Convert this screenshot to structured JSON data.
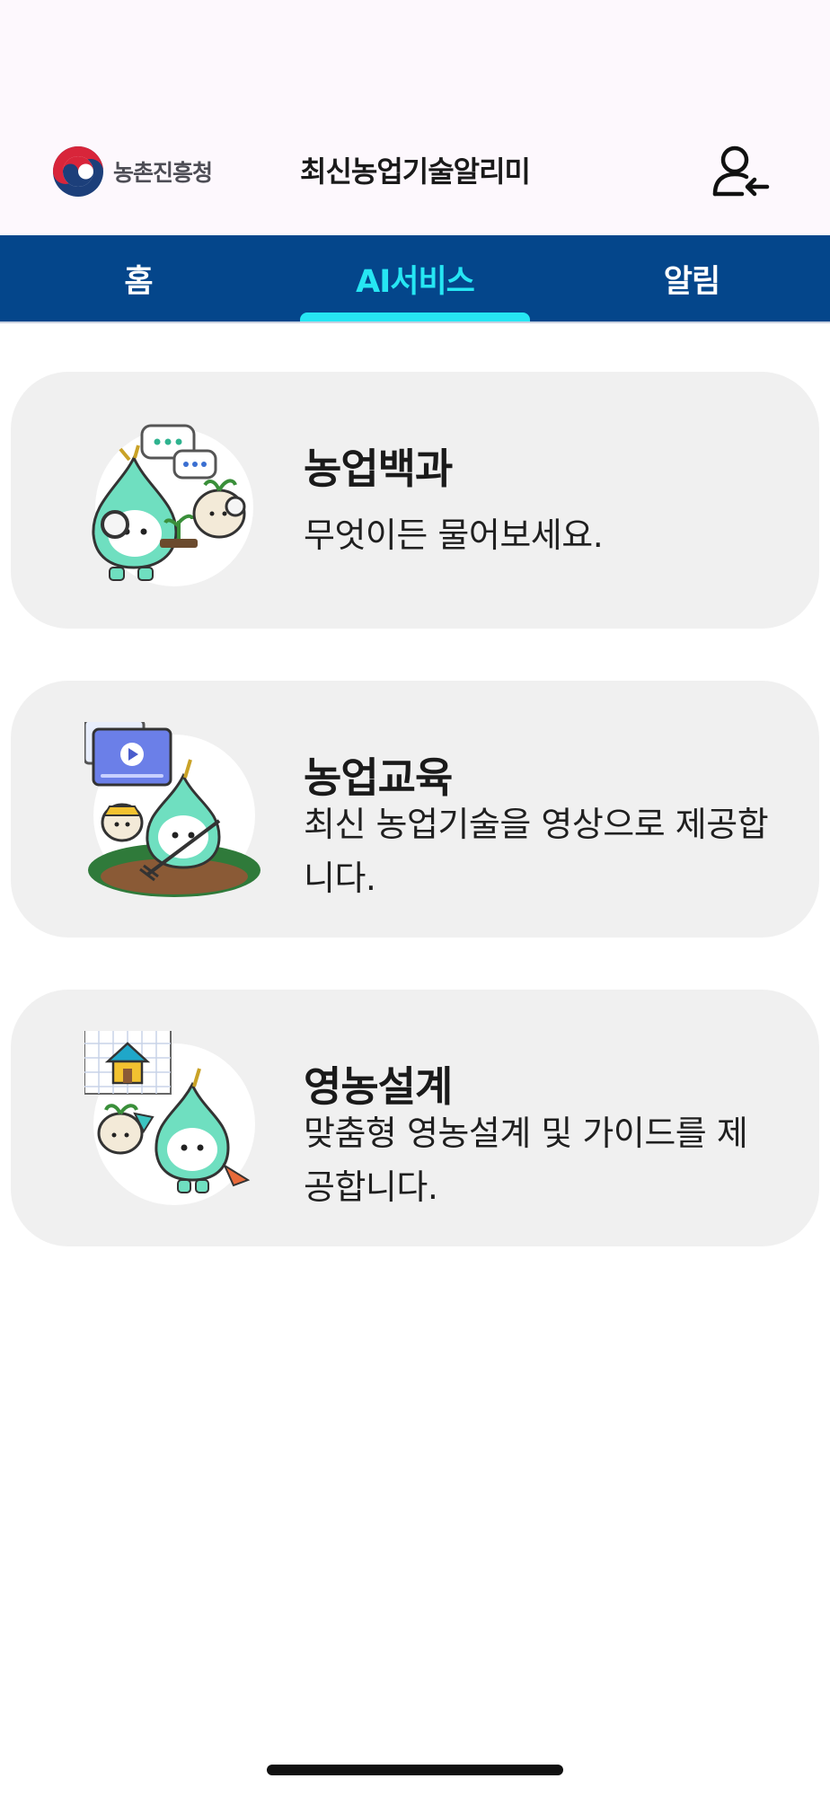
{
  "header": {
    "logo_text": "농촌진흥청",
    "app_title": "최신농업기술알리미",
    "login_icon": "user-login-icon"
  },
  "tabs": [
    {
      "label": "홈",
      "active": false
    },
    {
      "label": "AI서비스",
      "active": true
    },
    {
      "label": "알림",
      "active": false
    }
  ],
  "services": [
    {
      "title": "농업백과",
      "description": "무엇이든 물어보세요.",
      "icon": "mascot-encyclopedia-illustration"
    },
    {
      "title": "농업교육",
      "description": "최신 농업기술을 영상으로 제공합니다.",
      "icon": "mascot-education-video-illustration"
    },
    {
      "title": "영농설계",
      "description": "맞춤형 영농설계 및 가이드를 제공합니다.",
      "icon": "mascot-farm-design-illustration"
    }
  ],
  "colors": {
    "header_bg": "#fdf8fd",
    "tab_bar_bg": "#04468b",
    "tab_active": "#26e6f3",
    "card_bg": "#f0f0f0",
    "mascot_green": "#6fdfc0"
  }
}
